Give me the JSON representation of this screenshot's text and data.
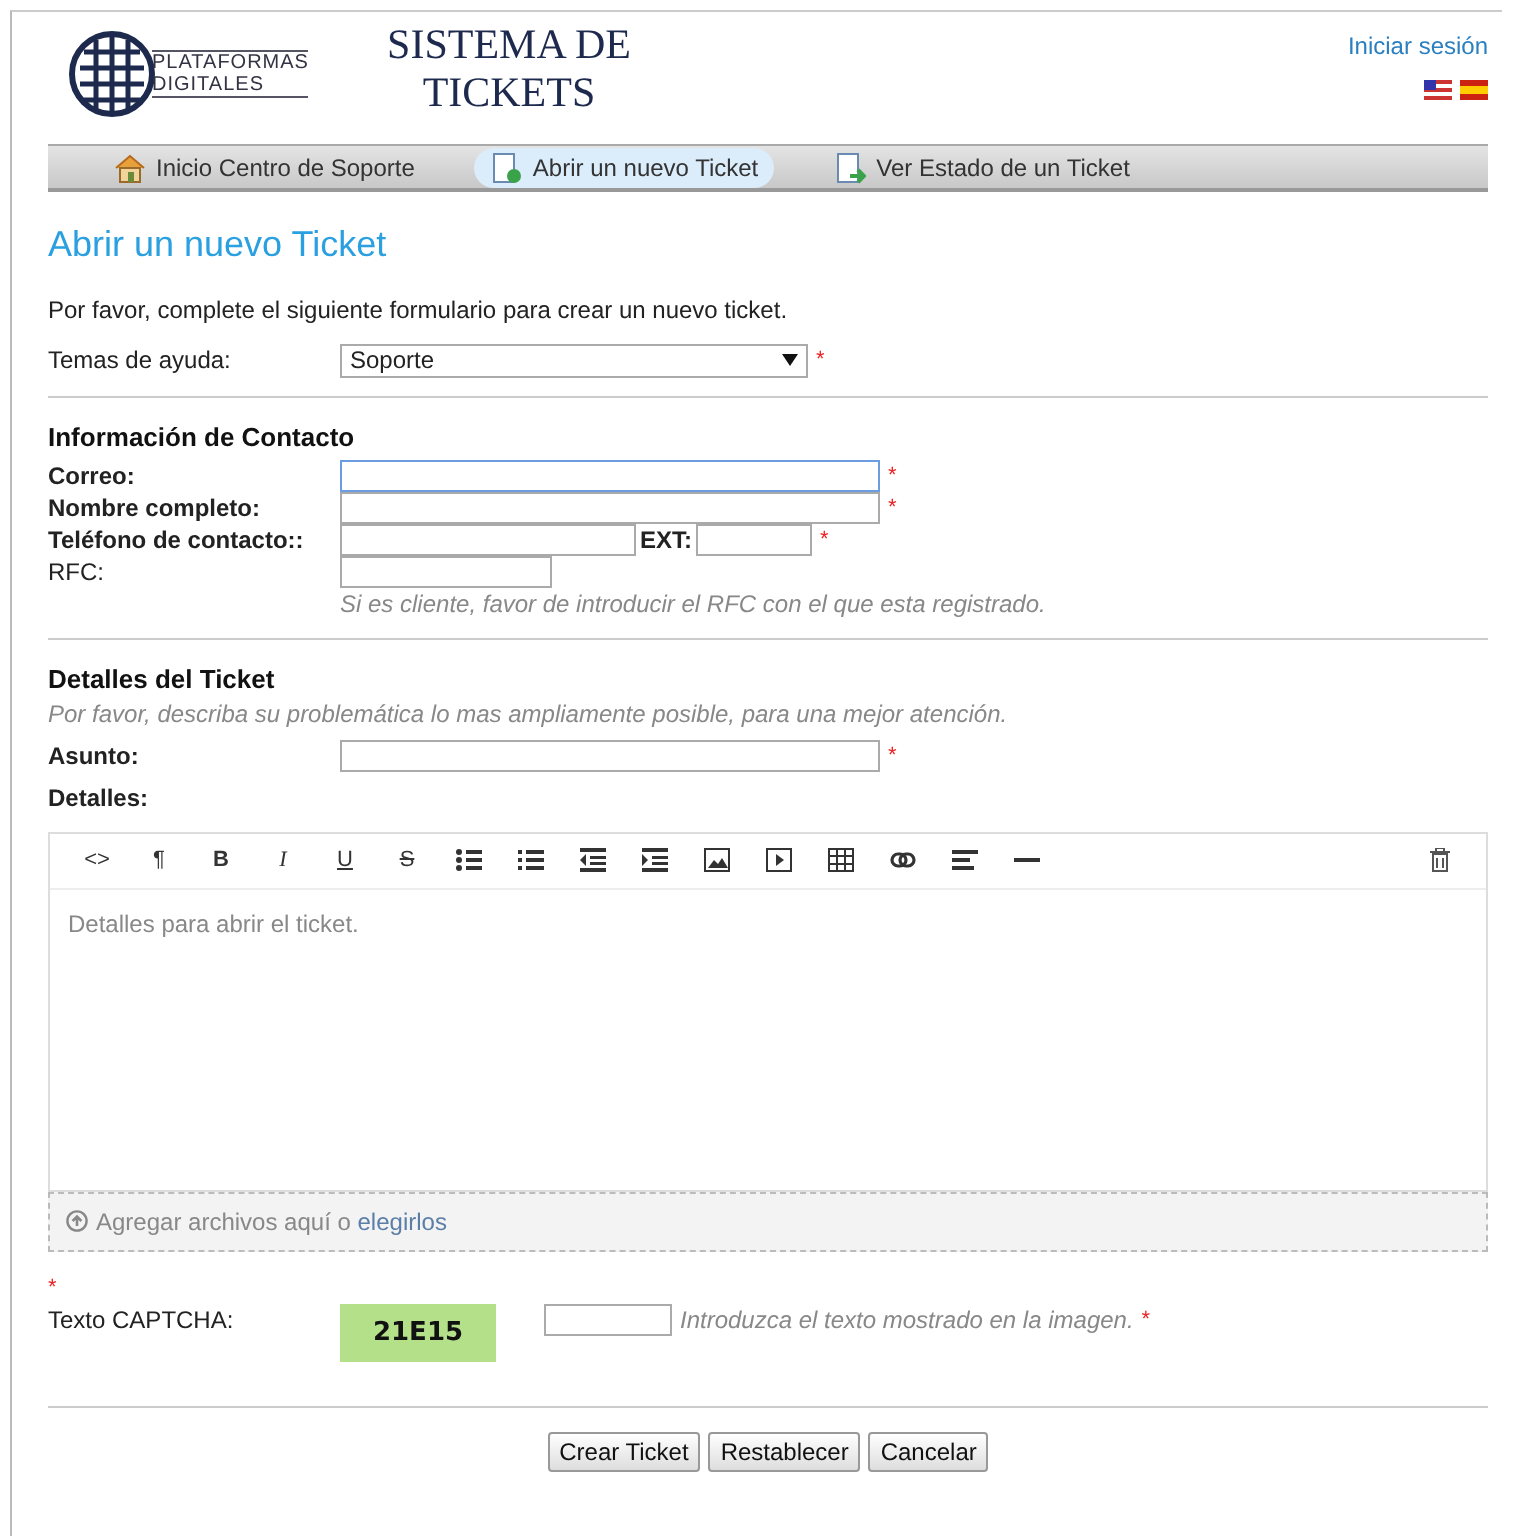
{
  "header": {
    "logo_top": "PLATAFORMAS",
    "logo_bottom": "DIGITALES",
    "title": "SISTEMA DE TICKETS",
    "login": "Iniciar sesión",
    "flags": [
      {
        "kind": "us"
      },
      {
        "kind": "es"
      }
    ]
  },
  "nav": [
    {
      "label": "Inicio Centro de Soporte",
      "kind": "home",
      "selected": false
    },
    {
      "label": "Abrir un nuevo Ticket",
      "kind": "new",
      "selected": true
    },
    {
      "label": "Ver Estado de un Ticket",
      "kind": "status",
      "selected": false
    }
  ],
  "page_title": "Abrir un nuevo Ticket",
  "intro": "Por favor, complete el siguiente formulario para crear un nuevo ticket.",
  "help_topic": {
    "label": "Temas de ayuda:",
    "value": "Soporte",
    "required": true
  },
  "contact": {
    "title": "Información de Contacto",
    "fields": [
      {
        "kind": "text",
        "label": "Correo:",
        "bold": true,
        "required": true,
        "focused": true
      },
      {
        "kind": "text",
        "label": "Nombre completo:",
        "bold": true,
        "required": true,
        "focused": false
      },
      {
        "kind": "phone",
        "label": "Teléfono de contacto::",
        "bold": true,
        "ext_label": "EXT:",
        "required": true,
        "focused": false
      },
      {
        "kind": "short",
        "label": "RFC:",
        "bold": false,
        "required": false,
        "focused": false,
        "hint": "Si es cliente, favor de introducir el RFC con el que esta registrado."
      }
    ]
  },
  "details": {
    "title": "Detalles del Ticket",
    "description": "Por favor, describa su problemática lo mas ampliamente posible, para una mejor atención.",
    "subject_label": "Asunto:",
    "subject_required": true,
    "details_label": "Detalles:",
    "toolbar": [
      {
        "kind": "code",
        "glyph": "<>"
      },
      {
        "kind": "text",
        "glyph": "¶"
      },
      {
        "kind": "text",
        "glyph": "B"
      },
      {
        "kind": "text",
        "glyph": "I"
      },
      {
        "kind": "text",
        "glyph": "U"
      },
      {
        "kind": "text",
        "glyph": "S"
      },
      {
        "kind": "ul"
      },
      {
        "kind": "ol"
      },
      {
        "kind": "outdent"
      },
      {
        "kind": "indent"
      },
      {
        "kind": "image"
      },
      {
        "kind": "video"
      },
      {
        "kind": "table"
      },
      {
        "kind": "link"
      },
      {
        "kind": "align"
      },
      {
        "kind": "hr"
      }
    ],
    "editor_placeholder": "Detalles para abrir el ticket.",
    "dropzone_text": "Agregar archivos aquí o",
    "dropzone_link": "elegirlos"
  },
  "captcha": {
    "star": "*",
    "label": "Texto CAPTCHA:",
    "code": "21E15",
    "hint": "Introduzca el texto mostrado en la imagen.",
    "required": true
  },
  "buttons": [
    "Crear Ticket",
    "Restablecer",
    "Cancelar"
  ]
}
